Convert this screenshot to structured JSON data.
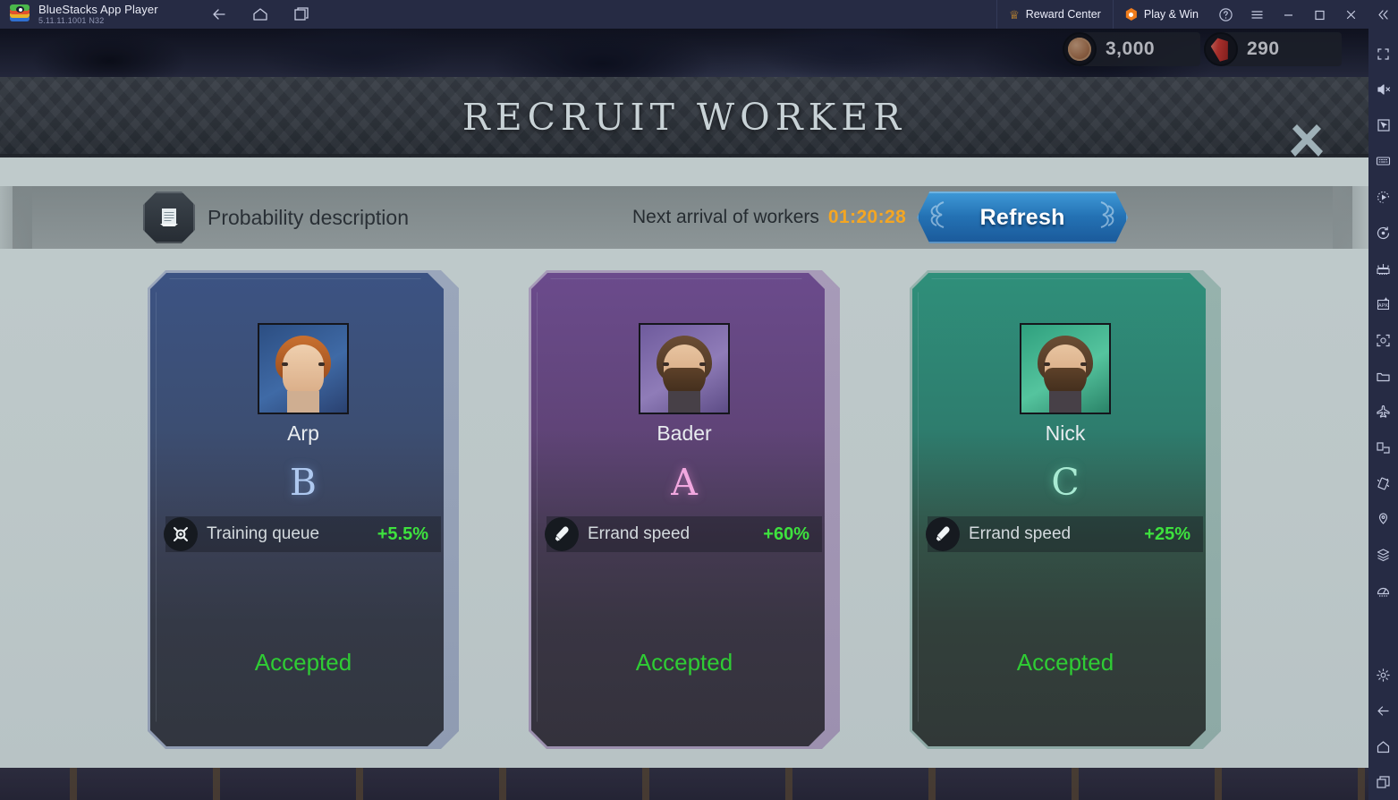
{
  "titlebar": {
    "app_name": "BlueStacks App Player",
    "version": "5.11.11.1001  N32",
    "nav": [
      {
        "name": "back-icon",
        "label": "Back"
      },
      {
        "name": "home-icon",
        "label": "Home"
      },
      {
        "name": "recents-icon",
        "label": "Recent apps"
      }
    ],
    "reward_center": "Reward Center",
    "play_and_win": "Play & Win",
    "help": "?",
    "menu": "☰",
    "minimize": "—",
    "maximize": "□",
    "close": "✕",
    "collapse": "«"
  },
  "currencies": [
    {
      "name": "coin",
      "value": "3,000",
      "icon": "coin-icon"
    },
    {
      "name": "gem",
      "value": "290",
      "icon": "gem-icon"
    }
  ],
  "modal": {
    "title": "RECRUIT WORKER",
    "close_label": "✕"
  },
  "toolbar": {
    "probability_label": "Probability description",
    "probability_icon": "scroll-icon",
    "timer_label": "Next arrival of workers",
    "timer_value": "01:20:28",
    "refresh_label": "Refresh"
  },
  "colors": {
    "accent_blue": "#2472b4",
    "timer_orange": "#f4a623",
    "positive_green": "#3ee23e",
    "accepted_green": "#2fcc34",
    "grade_a": "#f2a8e0",
    "grade_b": "#aec8ef",
    "grade_c": "#a9ead3"
  },
  "workers": [
    {
      "name": "Arp",
      "grade": "B",
      "trait_icon": "crossed-swords-icon",
      "trait_name": "Training queue",
      "trait_value": "+5.5%",
      "status": "Accepted",
      "rarity_color": "#3c5383"
    },
    {
      "name": "Bader",
      "grade": "A",
      "trait_icon": "boot-speed-icon",
      "trait_name": "Errand speed",
      "trait_value": "+60%",
      "status": "Accepted",
      "rarity_color": "#6b4b8c"
    },
    {
      "name": "Nick",
      "grade": "C",
      "trait_icon": "boot-speed-icon",
      "trait_name": "Errand speed",
      "trait_value": "+25%",
      "status": "Accepted",
      "rarity_color": "#2f8f7a"
    }
  ],
  "rail": {
    "items": [
      {
        "name": "fullscreen-icon",
        "label": "Fullscreen"
      },
      {
        "name": "mute-icon",
        "label": "Mute"
      },
      {
        "name": "cursor-icon",
        "label": "Pointer"
      },
      {
        "name": "keyboard-icon",
        "label": "Game controls"
      },
      {
        "name": "macro-play-icon",
        "label": "Macro recorder"
      },
      {
        "name": "sync-icon",
        "label": "Sync operations"
      },
      {
        "name": "multi-instance-icon",
        "label": "Multi-instance"
      },
      {
        "name": "apk-install-icon",
        "label": "Install APK"
      },
      {
        "name": "screenshot-icon",
        "label": "Screenshot"
      },
      {
        "name": "folder-icon",
        "label": "Media manager"
      },
      {
        "name": "airplane-icon",
        "label": "Airplane mode"
      },
      {
        "name": "rotate-screen-icon",
        "label": "Rotate"
      },
      {
        "name": "shake-icon",
        "label": "Shake"
      },
      {
        "name": "location-icon",
        "label": "Location"
      },
      {
        "name": "layers-icon",
        "label": "Layers"
      },
      {
        "name": "meter-icon",
        "label": "Performance"
      }
    ],
    "bottom": [
      {
        "name": "gear-icon",
        "label": "Settings"
      },
      {
        "name": "back-icon",
        "label": "Back"
      },
      {
        "name": "home-icon",
        "label": "Home"
      },
      {
        "name": "recents-icon",
        "label": "Recent apps"
      }
    ]
  }
}
